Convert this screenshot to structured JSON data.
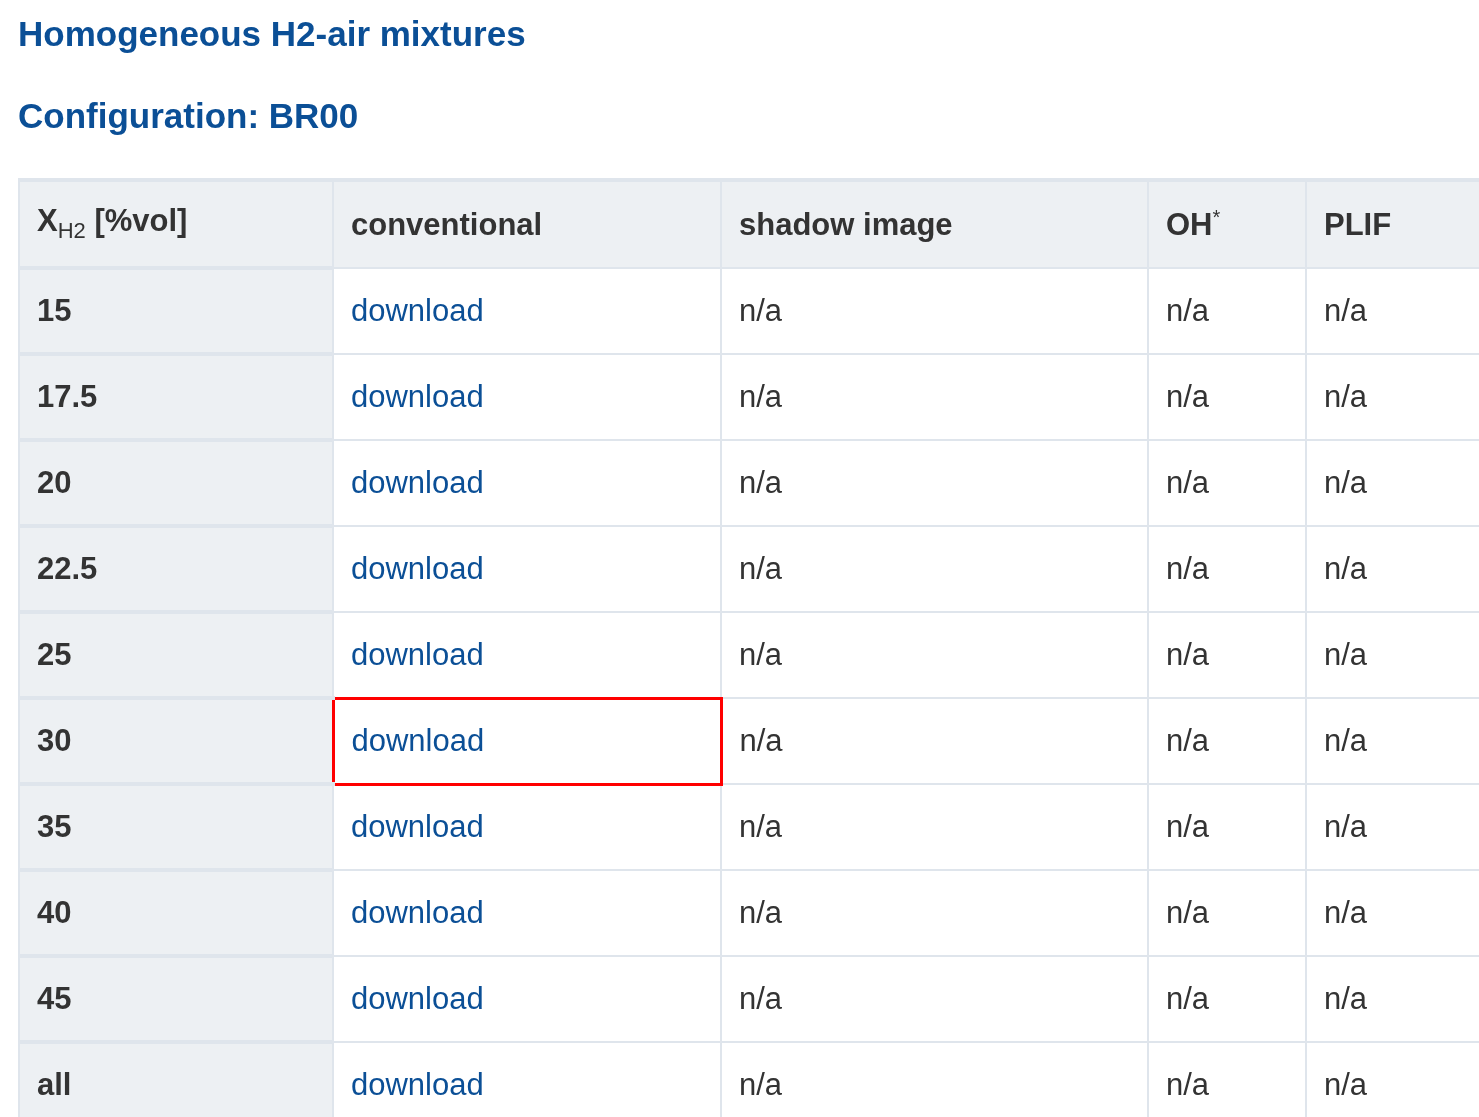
{
  "title": "Homogeneous H2-air mixtures",
  "subtitle": "Configuration: BR00",
  "table": {
    "columns": [
      "X$_{H2}$ [%vol]",
      "conventional",
      "shadow image",
      "OH$^{*}$",
      "PLIF"
    ],
    "rows": [
      {
        "cells": [
          "15",
          "download",
          "n/a",
          "n/a",
          "n/a"
        ],
        "highlighted": false
      },
      {
        "cells": [
          "17.5",
          "download",
          "n/a",
          "n/a",
          "n/a"
        ],
        "highlighted": false
      },
      {
        "cells": [
          "20",
          "download",
          "n/a",
          "n/a",
          "n/a"
        ],
        "highlighted": false
      },
      {
        "cells": [
          "22.5",
          "download",
          "n/a",
          "n/a",
          "n/a"
        ],
        "highlighted": false
      },
      {
        "cells": [
          "25",
          "download",
          "n/a",
          "n/a",
          "n/a"
        ],
        "highlighted": false
      },
      {
        "cells": [
          "30",
          "download",
          "n/a",
          "n/a",
          "n/a"
        ],
        "highlighted": true
      },
      {
        "cells": [
          "35",
          "download",
          "n/a",
          "n/a",
          "n/a"
        ],
        "highlighted": false
      },
      {
        "cells": [
          "40",
          "download",
          "n/a",
          "n/a",
          "n/a"
        ],
        "highlighted": false
      },
      {
        "cells": [
          "45",
          "download",
          "n/a",
          "n/a",
          "n/a"
        ],
        "highlighted": false
      },
      {
        "cells": [
          "all",
          "download",
          "n/a",
          "n/a",
          "n/a"
        ],
        "highlighted": false
      }
    ]
  }
}
